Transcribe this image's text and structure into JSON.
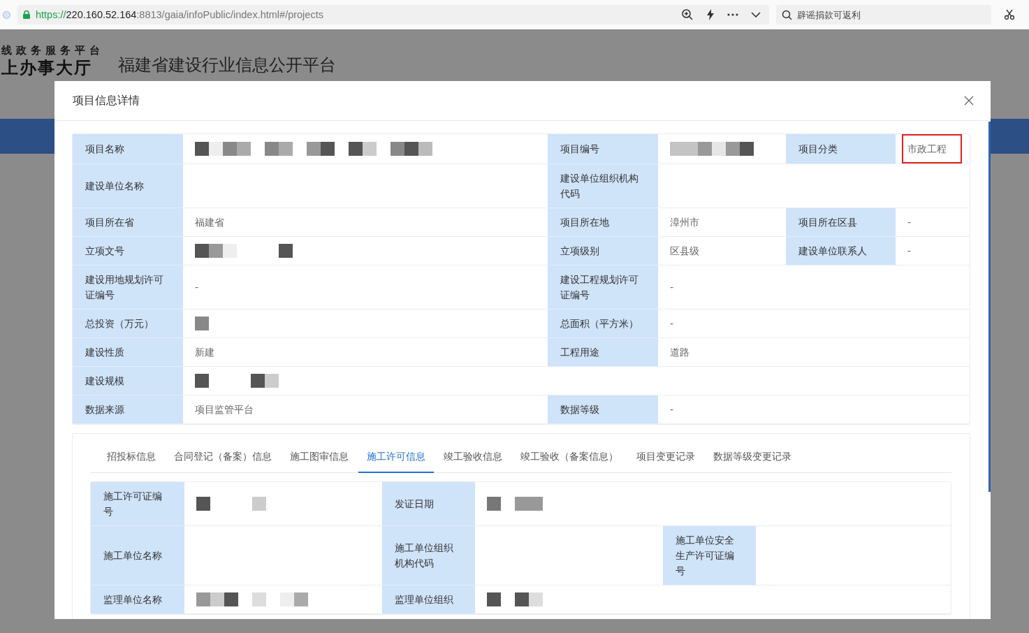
{
  "browser": {
    "url_scheme": "https://",
    "url_host": "220.160.52.164",
    "url_rest": ":8813/gaia/infoPublic/index.html#/projects",
    "search": {
      "placeholder": "辟谣捐款可返利"
    }
  },
  "site_header": {
    "subtitle": "线政务服务平台",
    "title": "上办事大厅",
    "platform": "福建省建设行业信息公开平台"
  },
  "modal": {
    "title": "项目信息详情"
  },
  "project_table": {
    "rows": [
      {
        "pairs": [
          {
            "label": "项目名称",
            "value": {
              "kind": "redacted"
            }
          },
          {
            "label": "项目编号",
            "value": {
              "kind": "redacted"
            }
          },
          {
            "label": "项目分类",
            "value": {
              "kind": "boxed",
              "text": "市政工程"
            }
          }
        ]
      },
      {
        "pairs": [
          {
            "label": "建设单位名称",
            "value": {
              "kind": "blank"
            }
          },
          {
            "label": "建设单位组织机构代码",
            "value": {
              "kind": "blank"
            }
          }
        ]
      },
      {
        "pairs": [
          {
            "label": "项目所在省",
            "value": {
              "kind": "text",
              "text": "福建省"
            }
          },
          {
            "label": "项目所在地",
            "value": {
              "kind": "text",
              "text": "漳州市"
            }
          },
          {
            "label": "项目所在区县",
            "value": {
              "kind": "text",
              "text": "-"
            }
          }
        ]
      },
      {
        "pairs": [
          {
            "label": "立项文号",
            "value": {
              "kind": "redacted"
            }
          },
          {
            "label": "立项级别",
            "value": {
              "kind": "text",
              "text": "区县级"
            }
          },
          {
            "label": "建设单位联系人",
            "value": {
              "kind": "text",
              "text": "-"
            }
          }
        ]
      },
      {
        "pairs": [
          {
            "label": "建设用地规划许可证编号",
            "value": {
              "kind": "text",
              "text": "-"
            }
          },
          {
            "label": "建设工程规划许可证编号",
            "value": {
              "kind": "text",
              "text": "-"
            }
          }
        ]
      },
      {
        "pairs": [
          {
            "label": "总投资（万元）",
            "value": {
              "kind": "redacted"
            }
          },
          {
            "label": "总面积（平方米）",
            "value": {
              "kind": "text",
              "text": "-"
            }
          }
        ]
      },
      {
        "pairs": [
          {
            "label": "建设性质",
            "value": {
              "kind": "text",
              "text": "新建"
            }
          },
          {
            "label": "工程用途",
            "value": {
              "kind": "text",
              "text": "道路"
            }
          }
        ]
      },
      {
        "pairs": [
          {
            "label": "建设规模",
            "value": {
              "kind": "redacted"
            }
          }
        ]
      },
      {
        "pairs": [
          {
            "label": "数据来源",
            "value": {
              "kind": "text",
              "text": "项目监管平台"
            }
          },
          {
            "label": "数据等级",
            "value": {
              "kind": "text",
              "text": "-"
            }
          }
        ]
      }
    ]
  },
  "tabs": [
    {
      "label": "招投标信息",
      "selected": false
    },
    {
      "label": "合同登记（备案）信息",
      "selected": false
    },
    {
      "label": "施工图审信息",
      "selected": false
    },
    {
      "label": "施工许可信息",
      "selected": true
    },
    {
      "label": "竣工验收信息",
      "selected": false
    },
    {
      "label": "竣工验收（备案信息）",
      "selected": false
    },
    {
      "label": "项目变更记录",
      "selected": false
    },
    {
      "label": "数据等级变更记录",
      "selected": false
    }
  ],
  "permit_table": {
    "rows": [
      {
        "pairs": [
          {
            "label": "施工许可证编号",
            "value": {
              "kind": "redacted"
            }
          },
          {
            "label": "发证日期",
            "value": {
              "kind": "redacted"
            }
          }
        ]
      },
      {
        "pairs": [
          {
            "label": "施工单位名称",
            "value": {
              "kind": "blank"
            }
          },
          {
            "label": "施工单位组织机构代码",
            "value": {
              "kind": "blank"
            }
          },
          {
            "label": "施工单位安全生产许可证编号",
            "value": {
              "kind": "blank"
            }
          }
        ]
      },
      {
        "pairs": [
          {
            "label": "监理单位名称",
            "value": {
              "kind": "redacted"
            }
          },
          {
            "label": "监理单位组织",
            "value": {
              "kind": "redacted"
            }
          }
        ]
      }
    ]
  }
}
